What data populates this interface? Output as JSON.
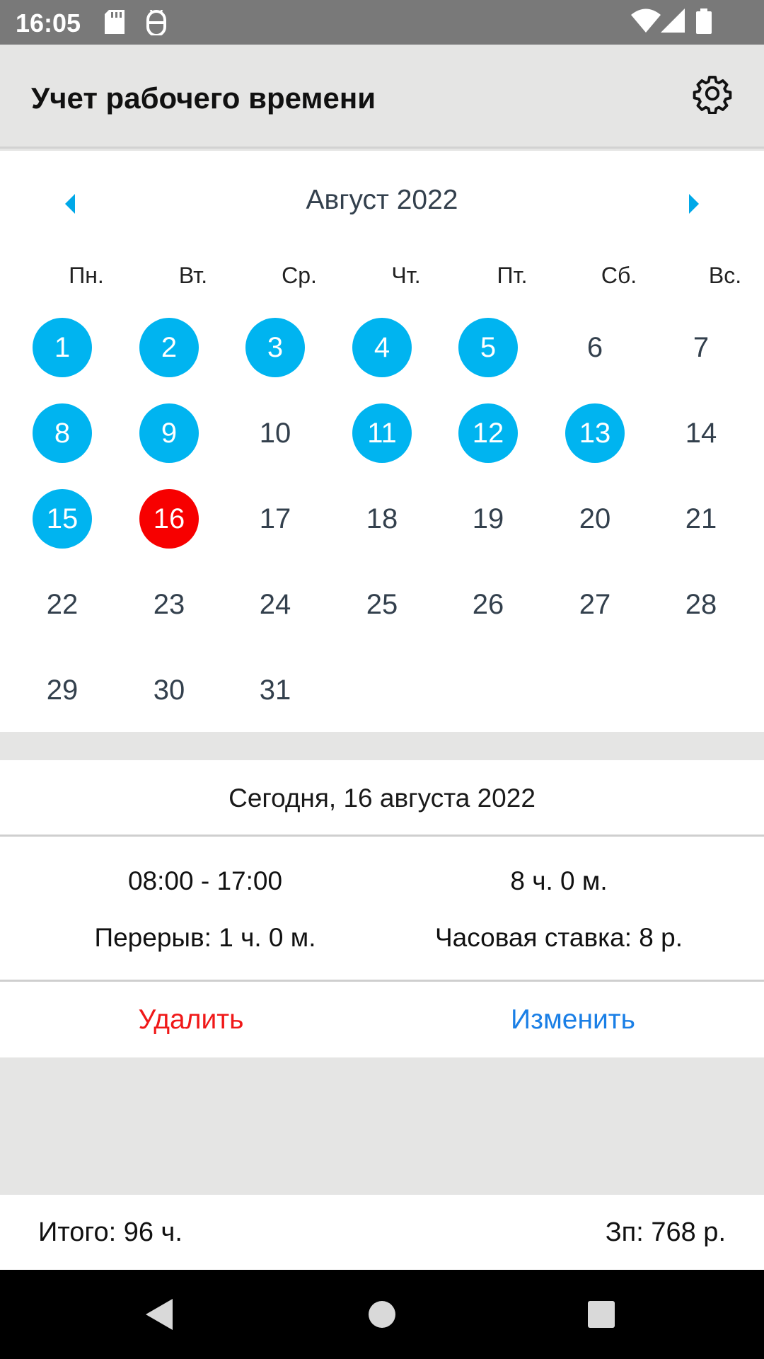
{
  "status_bar": {
    "time": "16:05",
    "left_icons": [
      "sd-card-icon",
      "android-debug-icon"
    ],
    "right_icons": [
      "wifi-icon",
      "signal-icon",
      "battery-icon"
    ]
  },
  "app_bar": {
    "title": "Учет рабочего времени",
    "settings_icon": "gear-icon"
  },
  "calendar": {
    "month_title": "Август 2022",
    "prev_icon": "arrow-left-icon",
    "next_icon": "arrow-right-icon",
    "weekdays": [
      "Пн.",
      "Вт.",
      "Ср.",
      "Чт.",
      "Пт.",
      "Сб.",
      "Вс."
    ],
    "first_weekday_index": 0,
    "days_in_month": 31,
    "worked_days": [
      1,
      2,
      3,
      4,
      5,
      8,
      9,
      11,
      12,
      13,
      15
    ],
    "selected_day": 16,
    "colors": {
      "worked": "#00b4f0",
      "selected": "#f70000",
      "text": "#33404d",
      "arrow": "#00a8e8"
    }
  },
  "day_info": {
    "date_label": "Сегодня, 16 августа 2022",
    "time_range": "08:00 - 17:00",
    "duration": "8 ч. 0 м.",
    "break": "Перерыв: 1 ч. 0 м.",
    "hourly_rate": "Часовая ставка: 8 р.",
    "delete_label": "Удалить",
    "edit_label": "Изменить"
  },
  "totals": {
    "total_hours": "Итого: 96 ч.",
    "salary": "Зп: 768 р."
  },
  "nav_bar": {
    "back_icon": "back-triangle-icon",
    "home_icon": "home-circle-icon",
    "recents_icon": "recents-square-icon"
  }
}
